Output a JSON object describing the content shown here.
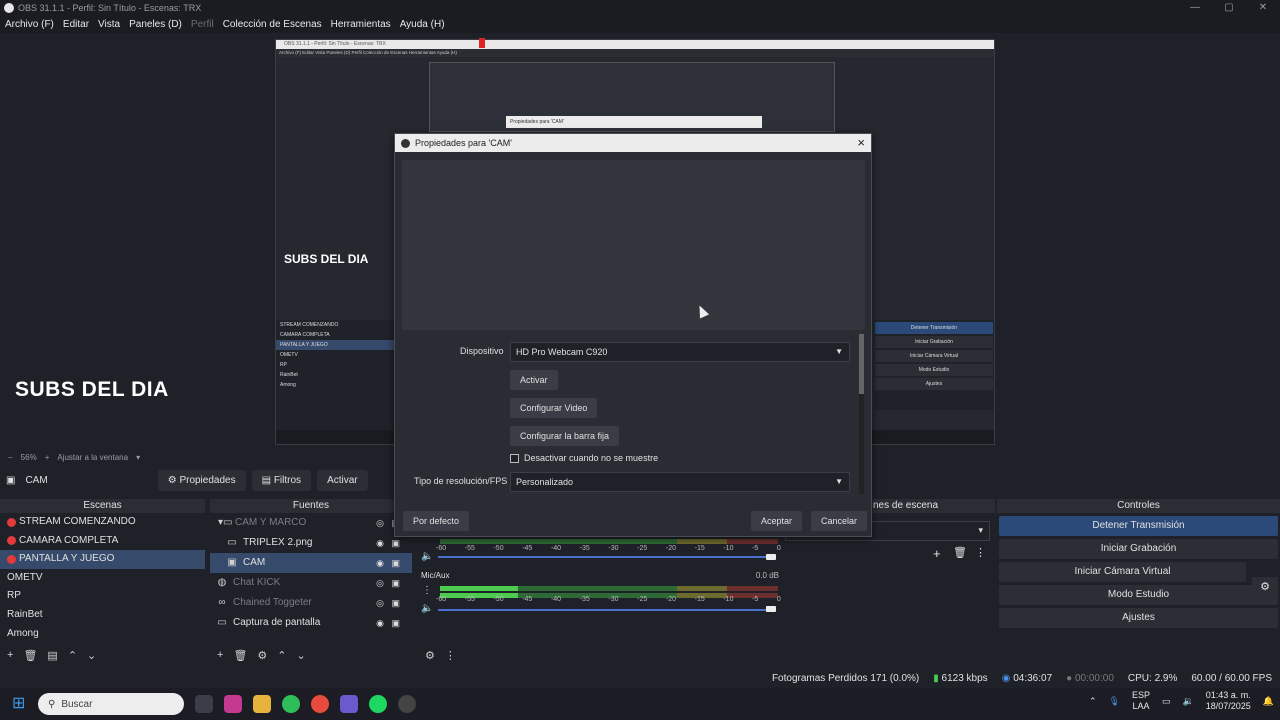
{
  "titlebar": {
    "title": "OBS 31.1.1 - Perfil: Sin Título - Escenas: TRX",
    "min": "—",
    "max": "▢",
    "close": "✕"
  },
  "menu": [
    {
      "label": "Archivo (F)",
      "disabled": false
    },
    {
      "label": "Editar",
      "disabled": false
    },
    {
      "label": "Vista",
      "disabled": false
    },
    {
      "label": "Paneles (D)",
      "disabled": false
    },
    {
      "label": "Perfil",
      "disabled": true
    },
    {
      "label": "Colección de Escenas",
      "disabled": false
    },
    {
      "label": "Herramientas",
      "disabled": false
    },
    {
      "label": "Ayuda (H)",
      "disabled": false
    }
  ],
  "preview": {
    "overlay_text": "SUBS DEL DIA",
    "zoom": "56%",
    "fit_label": "Ajustar a la ventana"
  },
  "nested": {
    "title": "OBS 31.1.1 - Perfil: Sin Título - Escenas: TRX",
    "menu": "Archivo (F)   Editar   Vista   Paneles (D)   Perfil   Colección de Escenas   Herramientas   Ayuda (H)",
    "props_bar": "Propiedades para 'CAM'",
    "overlay_text": "SUBS DEL DIA",
    "scenes": [
      "STREAM COMENZANDO",
      "CAMARA COMPLETA",
      "PANTALLA Y JUEGO",
      "OMETV",
      "RP",
      "RainBet",
      "Among"
    ],
    "controls": [
      "Detener Transmisión",
      "Iniciar Grabación",
      "Iniciar Cámara Virtual",
      "Modo Estudio",
      "Ajustes"
    ]
  },
  "source_toolbar": {
    "selected": "CAM",
    "props": "Propiedades",
    "filters": "Filtros",
    "activate": "Activar"
  },
  "docks": {
    "scenes": "Escenas",
    "sources": "Fuentes",
    "transitions": "nes de escena",
    "controls": "Controles"
  },
  "scenes": [
    {
      "name": "STREAM COMENZANDO",
      "live": true,
      "selected": false
    },
    {
      "name": "CAMARA COMPLETA",
      "live": true,
      "selected": false
    },
    {
      "name": "PANTALLA Y JUEGO",
      "live": true,
      "selected": true
    },
    {
      "name": "OMETV",
      "live": false,
      "selected": false
    },
    {
      "name": "RP",
      "live": false,
      "selected": false
    },
    {
      "name": "RainBet",
      "live": false,
      "selected": false
    },
    {
      "name": "Among",
      "live": false,
      "selected": false
    }
  ],
  "sources": [
    {
      "name": "CAM Y MARCO",
      "icon": "folder-icon",
      "dim": true,
      "selected": false
    },
    {
      "name": "TRIPLEX 2.png",
      "icon": "image-icon",
      "dim": false,
      "selected": false
    },
    {
      "name": "CAM",
      "icon": "camera-icon",
      "dim": false,
      "selected": true
    },
    {
      "name": "Chat KICK",
      "icon": "globe-icon",
      "dim": true,
      "selected": false
    },
    {
      "name": "Chained Toggeter",
      "icon": "link-icon",
      "dim": true,
      "selected": false
    },
    {
      "name": "Captura de pantalla",
      "icon": "monitor-icon",
      "dim": false,
      "selected": false
    }
  ],
  "mixer": {
    "ticks": [
      "-60",
      "-55",
      "-50",
      "-45",
      "-40",
      "-35",
      "-30",
      "-25",
      "-20",
      "-15",
      "-10",
      "-5",
      "0"
    ],
    "micaux_label": "Mic/Aux",
    "micaux_db": "0.0 dB"
  },
  "controls": [
    {
      "label": "Detener Transmisión",
      "active": true
    },
    {
      "label": "Iniciar Grabación",
      "active": false
    },
    {
      "label": "Iniciar Cámara Virtual",
      "active": false
    },
    {
      "label": "Modo Estudio",
      "active": false
    },
    {
      "label": "Ajustes",
      "active": false
    }
  ],
  "status": {
    "dropped": "Fotogramas Perdidos 171 (0.0%)",
    "bitrate": "6123 kbps",
    "stream_time": "04:36:07",
    "rec_time": "00:00:00",
    "cpu": "CPU: 2.9%",
    "fps": "60.00 / 60.00 FPS"
  },
  "dialog": {
    "title": "Propiedades para 'CAM'",
    "device_label": "Dispositivo",
    "device_value": "HD Pro Webcam C920",
    "activate": "Activar",
    "configure_video": "Configurar Video",
    "configure_crossbar": "Configurar la barra fija",
    "deactivate_label": "Desactivar cuando no se muestre",
    "res_label": "Tipo de resolución/FPS",
    "res_value": "Personalizado",
    "defaults": "Por defecto",
    "accept": "Aceptar",
    "cancel": "Cancelar"
  },
  "taskbar": {
    "search_placeholder": "Buscar",
    "lang": "ESP",
    "lang2": "LAA",
    "time": "01:43 a. m.",
    "date": "18/07/2025"
  }
}
